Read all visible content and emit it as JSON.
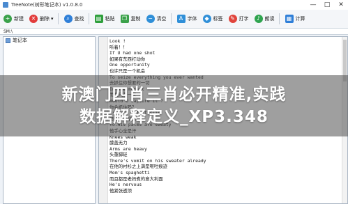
{
  "window": {
    "title": "TreeNote(树形笔记本) v1.0.8.0",
    "min": "—",
    "max": "□",
    "close": "✕"
  },
  "colors": {
    "accent": "#4a8ad0",
    "new": "#3aa14a",
    "delete": "#e23b3b",
    "find": "#2f7fd8",
    "paste": "#2e9f3c",
    "copy": "#3aa14a",
    "clear": "#2f8fd8",
    "font": "#2f8fd8",
    "tag": "#2f8fd8",
    "type": "#e0443c",
    "read": "#2fa44f",
    "count": "#2f7fd8"
  },
  "toolbar": {
    "new": "新建",
    "delete": "删除",
    "delete_arrow": "▾",
    "find": "查找",
    "paste": "粘贴",
    "copy": "复制",
    "clear": "清空",
    "font": "字体",
    "tag": "标签",
    "type": "打字",
    "read": "朗读",
    "count": "计算"
  },
  "path": "SM:\\",
  "tree": {
    "root": "笔记本"
  },
  "editor": {
    "lines": [
      "Look !",
      "听着！！",
      "If U had one shot",
      "如果有东西打动你",
      "One opportunity",
      "也许只是一个机会",
      "To seize everything you ever wanted",
      "去抓住你想要的一切",
      "In one moment",
      "而且只有一次",
      "Would U capture it ?",
      "你会抓住吗？",
      "Or just let it slip",
      "还是任它溜走",
      "Yo.His palms are sweaty",
      "他手心全是汗",
      "Knees weak",
      "膝盖无力",
      "Arms are heavy",
      "头重脚轻",
      "There's vomit on his sweater already",
      "在他的衬衫之上满是呕吐痕迹",
      "Mom's spaghetti",
      "而且都是老妈煮的意大利面",
      "He's nervous",
      "他紧张透顶"
    ]
  },
  "overlay": {
    "line1": "新澳门四肖三肖必开精准,实践",
    "line2": "数据解释定义_XP3.348"
  }
}
